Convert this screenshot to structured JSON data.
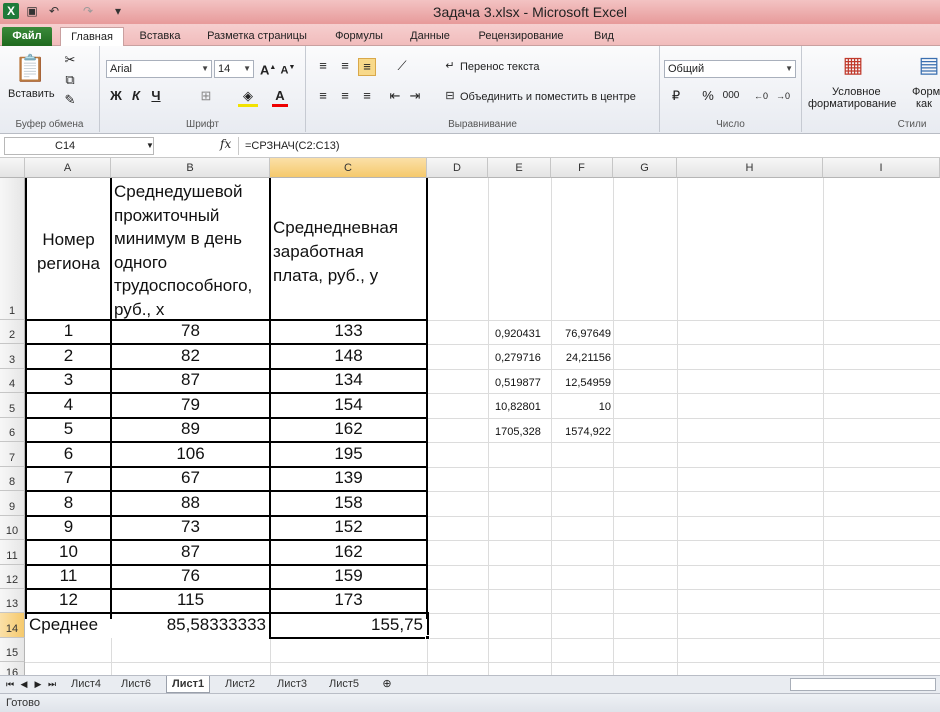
{
  "window": {
    "title": "Задача 3.xlsx  -  Microsoft Excel"
  },
  "ribbon_tabs": [
    {
      "label": "Файл"
    },
    {
      "label": "Главная"
    },
    {
      "label": "Вставка"
    },
    {
      "label": "Разметка страницы"
    },
    {
      "label": "Формулы"
    },
    {
      "label": "Данные"
    },
    {
      "label": "Рецензирование"
    },
    {
      "label": "Вид"
    }
  ],
  "ribbon": {
    "clipboard": {
      "paste_label": "Вставить",
      "group_label": "Буфер обмена"
    },
    "font": {
      "name": "Arial",
      "size": "14",
      "bold": "Ж",
      "italic": "К",
      "underline": "Ч",
      "group_label": "Шрифт"
    },
    "alignment": {
      "wrap_label": "Перенос текста",
      "merge_label": "Объединить и поместить в центре",
      "group_label": "Выравнивание"
    },
    "number": {
      "format": "Общий",
      "percent": "%",
      "thousands": "000",
      "group_label": "Число"
    },
    "styles": {
      "conditional_label_1": "Условное",
      "conditional_label_2": "форматирование",
      "format_label_1": "Форм",
      "format_label_2": "как",
      "group_label": "Стили"
    }
  },
  "formula_bar": {
    "name_box": "C14",
    "fx": "fx",
    "formula": "=СРЗНАЧ(C2:C13)"
  },
  "columns": [
    "A",
    "B",
    "C",
    "D",
    "E",
    "F",
    "G",
    "H",
    "I"
  ],
  "rows": [
    "1",
    "2",
    "3",
    "4",
    "5",
    "6",
    "7",
    "8",
    "9",
    "10",
    "11",
    "12",
    "13",
    "14",
    "15",
    "16"
  ],
  "headers": {
    "a_lines": [
      "Номер",
      "региона"
    ],
    "b_lines": [
      "Среднедушевой",
      "прожиточный",
      "минимум в день",
      "одного",
      "трудоспособного,",
      "руб., х"
    ],
    "c_lines": [
      "Среднедневная",
      "заработная",
      "плата, руб., у"
    ]
  },
  "table": [
    [
      "1",
      "78",
      "133"
    ],
    [
      "2",
      "82",
      "148"
    ],
    [
      "3",
      "87",
      "134"
    ],
    [
      "4",
      "79",
      "154"
    ],
    [
      "5",
      "89",
      "162"
    ],
    [
      "6",
      "106",
      "195"
    ],
    [
      "7",
      "67",
      "139"
    ],
    [
      "8",
      "88",
      "158"
    ],
    [
      "9",
      "73",
      "152"
    ],
    [
      "10",
      "87",
      "162"
    ],
    [
      "11",
      "76",
      "159"
    ],
    [
      "12",
      "115",
      "173"
    ]
  ],
  "summary": {
    "label": "Среднее",
    "b": "85,58333333",
    "c": "155,75"
  },
  "side_values": [
    [
      "0,920431",
      "76,97649"
    ],
    [
      "0,279716",
      "24,21156"
    ],
    [
      "0,519877",
      "12,54959"
    ],
    [
      "10,82801",
      "10"
    ],
    [
      "1705,328",
      "1574,922"
    ]
  ],
  "sheets": [
    {
      "label": "Лист4"
    },
    {
      "label": "Лист6"
    },
    {
      "label": "Лист1"
    },
    {
      "label": "Лист2"
    },
    {
      "label": "Лист3"
    },
    {
      "label": "Лист5"
    }
  ],
  "active_sheet": "Лист1",
  "status": "Готово"
}
